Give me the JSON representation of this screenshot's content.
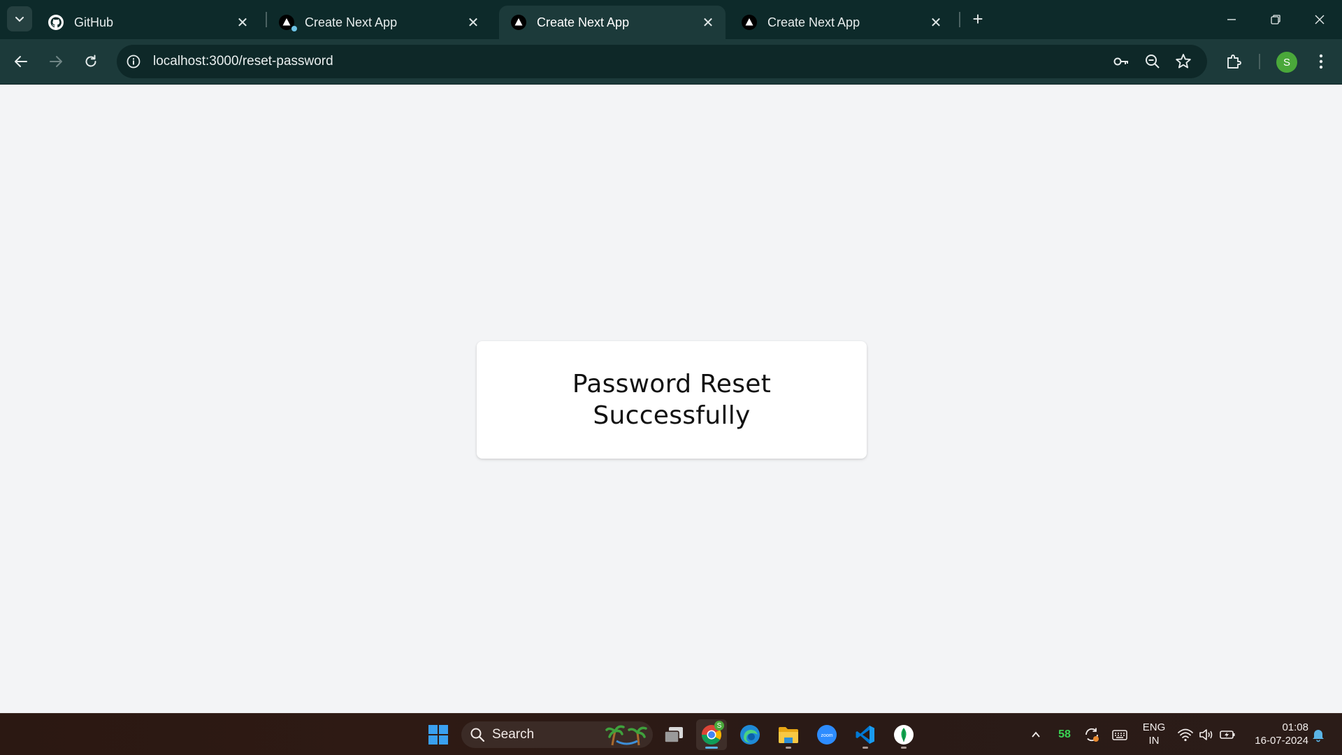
{
  "browser": {
    "tabs": [
      {
        "title": "GitHub",
        "icon": "github-icon",
        "active": false
      },
      {
        "title": "Create Next App",
        "icon": "nextjs-icon",
        "active": false
      },
      {
        "title": "Create Next App",
        "icon": "nextjs-icon",
        "active": true
      },
      {
        "title": "Create Next App",
        "icon": "nextjs-icon",
        "active": false
      }
    ],
    "url": "localhost:3000/reset-password",
    "profile_initial": "S"
  },
  "page": {
    "message_line1": "Password Reset",
    "message_line2": "Successfully"
  },
  "taskbar": {
    "search_placeholder": "Search",
    "apps": [
      "windows-start",
      "search",
      "task-view",
      "chrome",
      "edge",
      "file-explorer",
      "zoom",
      "vscode",
      "mongodb-compass"
    ],
    "chrome_badge": "S",
    "zoom_label": "zoom",
    "tray": {
      "counter": "58",
      "language_line1": "ENG",
      "language_line2": "IN",
      "time": "01:08",
      "date": "16-07-2024"
    }
  },
  "colors": {
    "titlebar": "#0d2a2a",
    "toolbar": "#1c3a3a",
    "page_bg": "#f3f4f6",
    "card_bg": "#ffffff",
    "counter": "#39d353"
  }
}
